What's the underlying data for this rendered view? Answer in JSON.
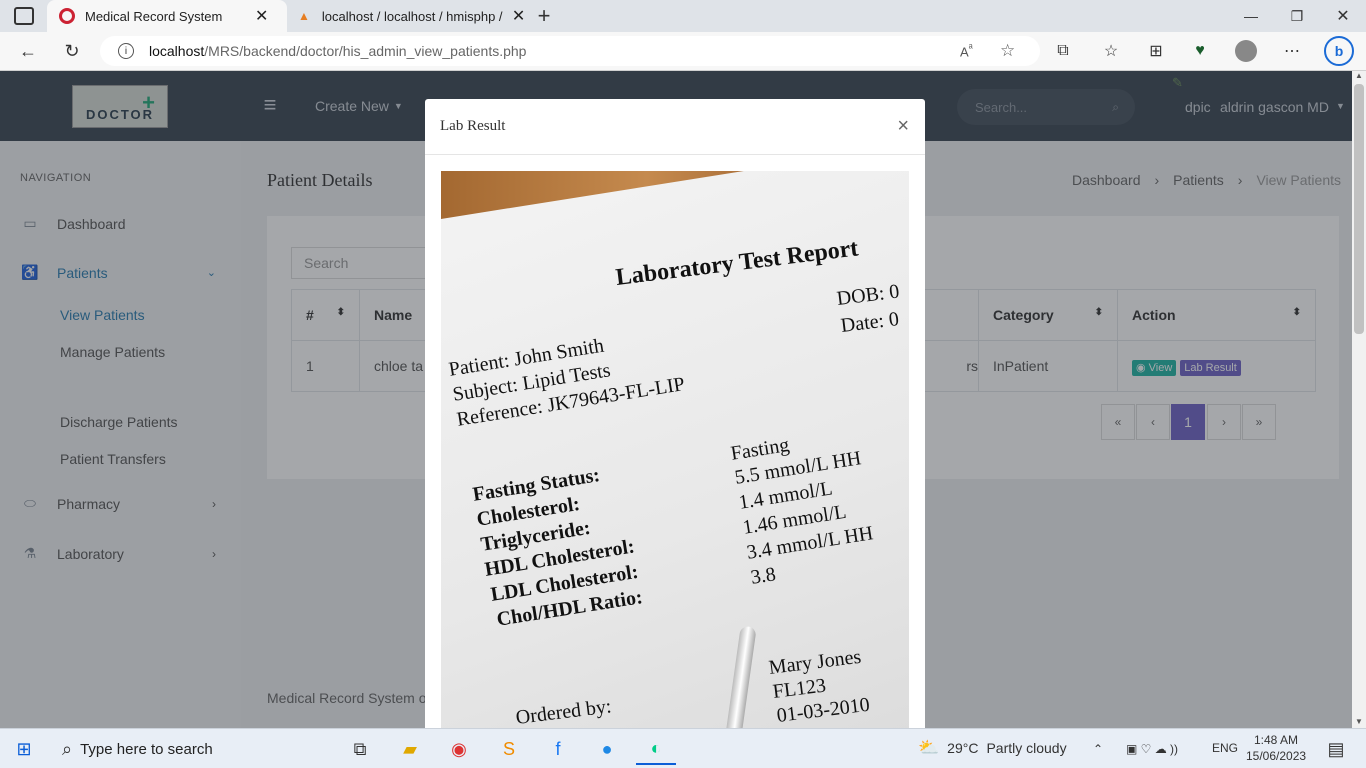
{
  "browser": {
    "tabs": [
      {
        "title": "Medical Record System"
      },
      {
        "title": "localhost / localhost / hmisphp /"
      }
    ],
    "url_host": "localhost",
    "url_path": "/MRS/backend/doctor/his_admin_view_patients.php"
  },
  "topnav": {
    "logo_text": "DOCTOR",
    "create_new": "Create New",
    "search_placeholder": "Search...",
    "user_avatar_text": "dpic",
    "user_name": "aldrin gascon MD"
  },
  "sidebar": {
    "heading": "NAVIGATION",
    "items": [
      {
        "label": "Dashboard"
      },
      {
        "label": "Patients"
      },
      {
        "label": "Pharmacy"
      },
      {
        "label": "Laboratory"
      }
    ],
    "patients_sub": [
      {
        "label": "View Patients"
      },
      {
        "label": "Manage Patients"
      },
      {
        "label": "Discharge Patients"
      },
      {
        "label": "Patient Transfers"
      }
    ]
  },
  "page": {
    "title": "Patient Details",
    "breadcrumb": [
      "Dashboard",
      "Patients",
      "View Patients"
    ],
    "search_placeholder": "Search",
    "footer": "Medical Record System o"
  },
  "table": {
    "headers": [
      "#",
      "Name",
      "Category",
      "Action"
    ],
    "row": {
      "num": "1",
      "name": "chloe ta",
      "partial": "rs",
      "category": "InPatient",
      "view_label": "View",
      "lab_label": "Lab Result"
    },
    "pager": [
      "«",
      "‹",
      "1",
      "›",
      "»"
    ]
  },
  "modal": {
    "title": "Lab Result",
    "close": "×"
  },
  "report": {
    "title": "Laboratory Test Report",
    "dob": "DOB: 0",
    "date": "Date:  0",
    "patient": "Patient: John Smith",
    "subject": "Subject: Lipid Tests",
    "reference": "Reference: JK79643-FL-LIP",
    "fasting_head": "Fasting",
    "labels": [
      "Fasting Status:",
      "Cholesterol:",
      "Triglyceride:",
      "HDL Cholesterol:",
      "LDL Cholesterol:",
      "Chol/HDL Ratio:"
    ],
    "values": [
      "5.5 mmol/L HH",
      "1.4 mmol/L",
      "1.46 mmol/L",
      "3.4 mmol/L HH",
      "3.8"
    ],
    "ordered_by": "Ordered by:",
    "doctor": "Mary Jones",
    "doc_code": "FL123",
    "doc_date": "01-03-2010"
  },
  "taskbar": {
    "search_placeholder": "Type here to search",
    "weather_temp": "29°C",
    "weather_desc": "Partly cloudy",
    "lang": "ENG",
    "time": "1:48 AM",
    "date": "15/06/2023"
  }
}
